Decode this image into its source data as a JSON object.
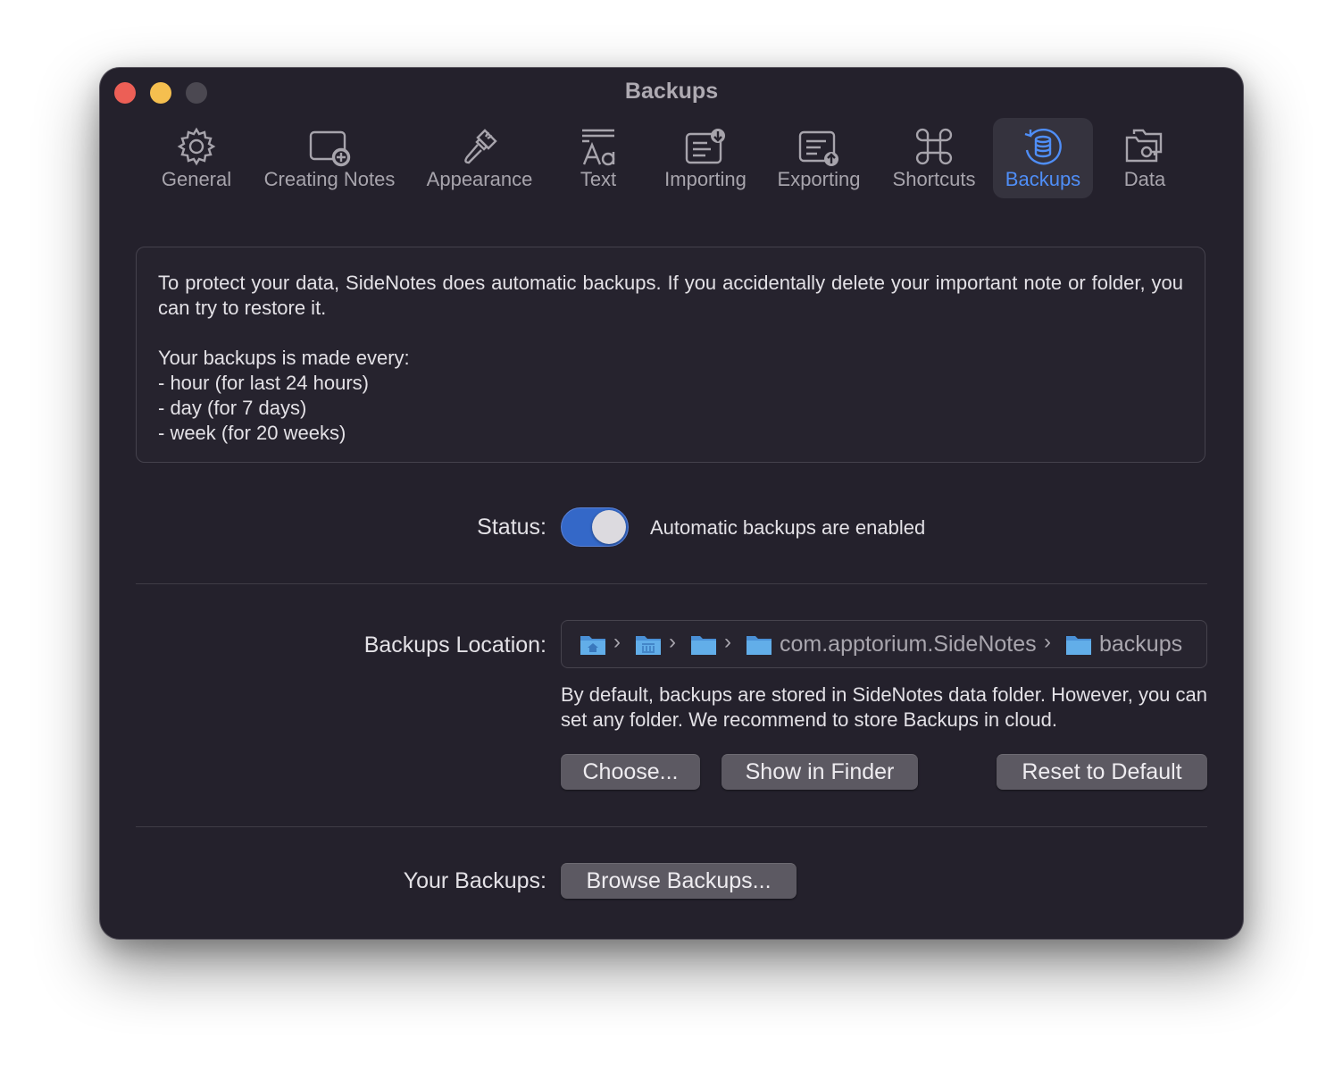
{
  "window": {
    "title": "Backups"
  },
  "tabs": [
    {
      "id": "general",
      "label": "General",
      "icon": "gear-icon"
    },
    {
      "id": "creating-notes",
      "label": "Creating Notes",
      "icon": "note-plus-icon"
    },
    {
      "id": "appearance",
      "label": "Appearance",
      "icon": "paintbrush-icon"
    },
    {
      "id": "text",
      "label": "Text",
      "icon": "text-format-icon"
    },
    {
      "id": "importing",
      "label": "Importing",
      "icon": "import-icon"
    },
    {
      "id": "exporting",
      "label": "Exporting",
      "icon": "export-icon"
    },
    {
      "id": "shortcuts",
      "label": "Shortcuts",
      "icon": "command-icon"
    },
    {
      "id": "backups",
      "label": "Backups",
      "icon": "backup-database-icon",
      "active": true
    },
    {
      "id": "data",
      "label": "Data",
      "icon": "data-folders-icon"
    }
  ],
  "info": {
    "intro": "To protect your data, SideNotes does automatic backups. If you accidentally delete your important note or folder, you can try to restore it.",
    "schedule_title": "Your backups is made every:",
    "schedule_items": [
      "- hour (for last 24 hours)",
      "- day (for 7 days)",
      "- week (for 20 weeks)"
    ]
  },
  "status": {
    "label": "Status:",
    "enabled": true,
    "text": "Automatic backups are enabled"
  },
  "location": {
    "label": "Backups Location:",
    "path": [
      {
        "icon": "home-folder-icon",
        "text": ""
      },
      {
        "icon": "library-folder-icon",
        "text": ""
      },
      {
        "icon": "folder-icon",
        "text": ""
      },
      {
        "icon": "folder-icon",
        "text": "com.apptorium.SideNotes"
      },
      {
        "icon": "folder-icon",
        "text": "backups"
      }
    ],
    "description": "By default, backups are stored in SideNotes data folder. However, you can set any folder. We recommend to store Backups in cloud.",
    "choose_label": "Choose...",
    "show_label": "Show in Finder",
    "reset_label": "Reset to Default"
  },
  "your_backups": {
    "label": "Your Backups:",
    "browse_label": "Browse Backups..."
  },
  "colors": {
    "accent": "#4f8ef7",
    "window_bg": "#24212c",
    "toggle_on": "#3468c8",
    "close": "#ec5f56",
    "minimize": "#f5bf4f",
    "folder_blue": "#5aa6e8"
  }
}
